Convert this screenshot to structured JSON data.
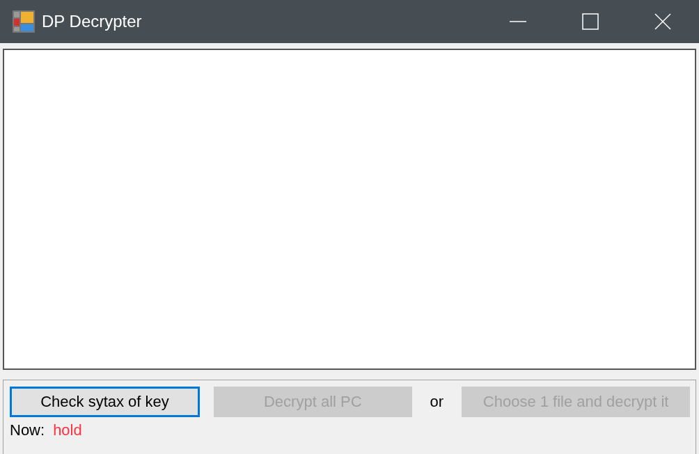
{
  "window": {
    "title": "DP Decrypter"
  },
  "buttons": [
    {
      "label": "Check sytax of key",
      "disabled": false,
      "focused": true
    },
    {
      "label": "Decrypt all PC",
      "disabled": true,
      "focused": false
    },
    {
      "label": "or",
      "kind": "text"
    },
    {
      "label": "Choose 1 file and decrypt it",
      "disabled": true,
      "focused": false
    }
  ],
  "status": {
    "label": "Now:",
    "value": "hold"
  }
}
